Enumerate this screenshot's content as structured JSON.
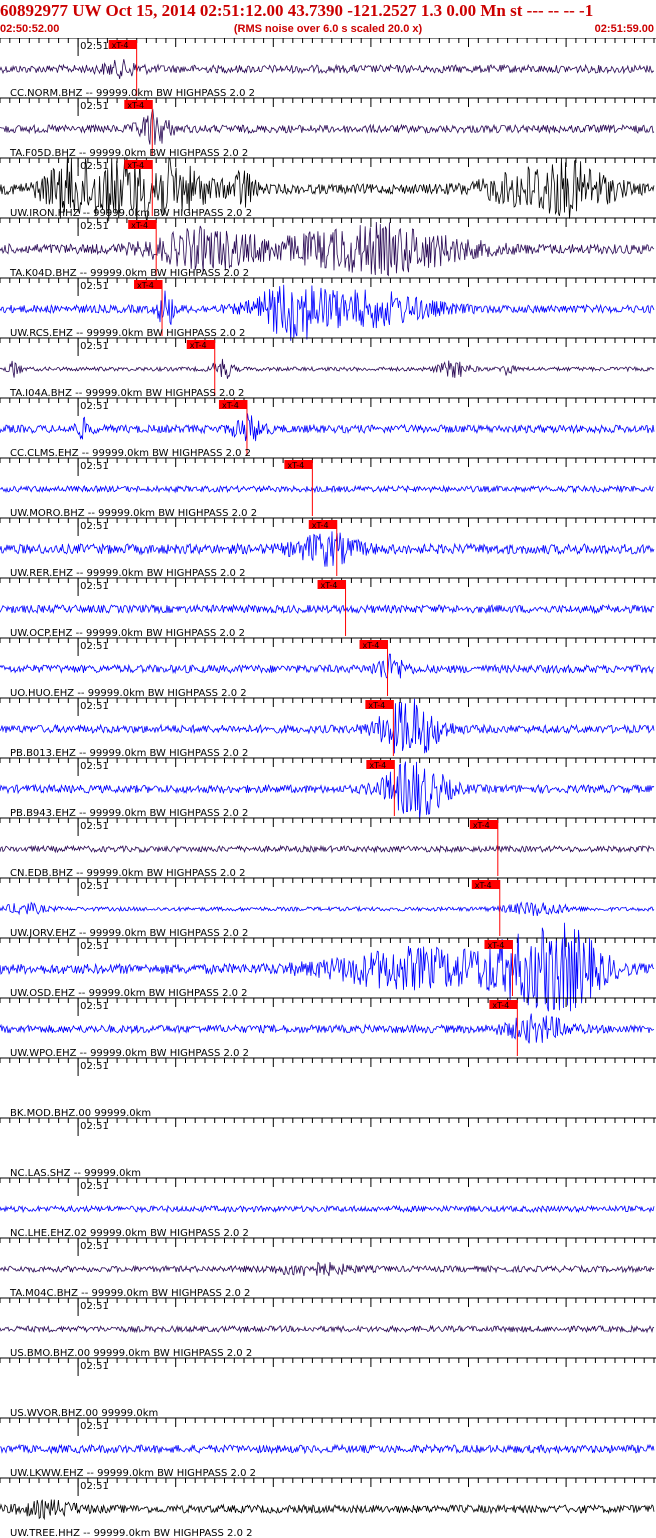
{
  "header": {
    "title": "60892977 UW Oct 15, 2014 02:51:12.00   43.7390 -121.2527  1.3 0.00 Mn st --- -- --  -1",
    "start_time": "02:50:52.00",
    "rms_note": "(RMS noise over 6.0 s scaled 20.0 x)",
    "end_time": "02:51:59.00"
  },
  "colors": {
    "header_red": "#cc0000",
    "pick_red": "#ff0000",
    "trace_blue": "#0000ff",
    "trace_purple": "#2a0a55",
    "trace_black": "#000000",
    "grid": "#000000"
  },
  "chart_data": {
    "type": "line",
    "title": "60892977 UW Oct 15, 2014 02:51:12.00   43.7390 -121.2527  1.3 0.00 Mn st --- -- --  -1",
    "x_range": [
      "02:50:52.00",
      "02:51:59.00"
    ],
    "x_range_seconds": [
      0,
      67
    ],
    "minute_label": "02:51",
    "minute_mark_seconds": 8,
    "pick_label": "xT-4",
    "traces": [
      {
        "label": "CC.NORM.BHZ -- 99999.0km BW  HIGHPASS  2.0  2",
        "color": "purple",
        "pick": 14.0,
        "amp": 4,
        "bursts": [
          [
            12.5,
            2.0,
            6
          ]
        ]
      },
      {
        "label": "TA.F05D.BHZ -- 99999.0km BW  HIGHPASS  2.0  2",
        "color": "purple",
        "pick": 15.6,
        "amp": 4,
        "bursts": [
          [
            15.8,
            1.5,
            16
          ]
        ]
      },
      {
        "label": "UW.IRON.HHZ -- 99999.0km BW  HIGHPASS  2.0  2",
        "color": "black",
        "pick": 15.6,
        "amp": 5,
        "bursts": [
          [
            6.5,
            1.8,
            12
          ],
          [
            9.5,
            4.5,
            22
          ],
          [
            16.5,
            5.0,
            26
          ],
          [
            25.0,
            1.0,
            18
          ],
          [
            54.5,
            5.0,
            16
          ],
          [
            59.0,
            4.0,
            18
          ]
        ]
      },
      {
        "label": "TA.K04D.BHZ -- 99999.0km BW  HIGHPASS  2.0  2",
        "color": "purple",
        "pick": 16.0,
        "amp": 5,
        "bursts": [
          [
            21.0,
            5.0,
            18
          ],
          [
            35.0,
            8.0,
            12
          ],
          [
            41.0,
            7.0,
            14
          ]
        ]
      },
      {
        "label": "UW.RCS.EHZ -- 99999.0km BW  HIGHPASS  2.0  2",
        "color": "blue",
        "pick": 16.6,
        "amp": 4,
        "bursts": [
          [
            17.0,
            0.8,
            18
          ],
          [
            30.0,
            3.5,
            26
          ],
          [
            38.0,
            6.0,
            16
          ]
        ]
      },
      {
        "label": "TA.I04A.BHZ -- 99999.0km BW  HIGHPASS  2.0  2",
        "color": "purple",
        "pick": 22.0,
        "amp": 2,
        "bursts": [
          [
            1.5,
            0.6,
            8
          ],
          [
            22.8,
            1.0,
            10
          ],
          [
            46.5,
            1.5,
            8
          ],
          [
            52.0,
            0.6,
            6
          ]
        ]
      },
      {
        "label": "CC.CLMS.EHZ -- 99999.0km BW  HIGHPASS  2.0  2",
        "color": "blue",
        "pick": 25.3,
        "amp": 4,
        "bursts": [
          [
            8.5,
            0.8,
            8
          ],
          [
            25.5,
            1.5,
            12
          ]
        ]
      },
      {
        "label": "UW.MORO.BHZ -- 99999.0km BW  HIGHPASS  2.0  2",
        "color": "blue",
        "pick": 32.0,
        "amp": 3,
        "bursts": []
      },
      {
        "label": "UW.RER.EHZ -- 99999.0km BW  HIGHPASS  2.0  2",
        "color": "blue",
        "pick": 34.5,
        "amp": 5,
        "bursts": [
          [
            33.5,
            3.0,
            14
          ]
        ]
      },
      {
        "label": "UW.OCP.EHZ -- 99999.0km BW  HIGHPASS  2.0  2",
        "color": "blue",
        "pick": 35.4,
        "amp": 4,
        "bursts": []
      },
      {
        "label": "UO.HUO.EHZ -- 99999.0km BW  HIGHPASS  2.0  2",
        "color": "blue",
        "pick": 39.7,
        "amp": 4,
        "bursts": [
          [
            40.0,
            1.5,
            12
          ]
        ]
      },
      {
        "label": "PB.B013.EHZ -- 99999.0km BW  HIGHPASS  2.0  2",
        "color": "blue",
        "pick": 40.3,
        "amp": 4,
        "bursts": [
          [
            42.0,
            3.0,
            28
          ]
        ]
      },
      {
        "label": "PB.B943.EHZ -- 99999.0km BW  HIGHPASS  2.0  2",
        "color": "blue",
        "pick": 40.4,
        "amp": 4,
        "bursts": [
          [
            42.5,
            3.0,
            28
          ]
        ]
      },
      {
        "label": "CN.EDB.BHZ -- 99999.0km BW  HIGHPASS  2.0  2",
        "color": "purple",
        "pick": 51.0,
        "amp": 3,
        "bursts": []
      },
      {
        "label": "UW.JORV.EHZ -- 99999.0km BW  HIGHPASS  2.0  2",
        "color": "blue",
        "pick": 51.2,
        "amp": 2,
        "bursts": [
          [
            2.5,
            2.0,
            5
          ],
          [
            55.0,
            3.0,
            6
          ]
        ]
      },
      {
        "label": "UW.OSD.EHZ -- 99999.0km BW  HIGHPASS  2.0  2",
        "color": "blue",
        "pick": 52.5,
        "amp": 5,
        "bursts": [
          [
            42.0,
            8.0,
            18
          ],
          [
            54.0,
            5.0,
            26
          ],
          [
            58.5,
            3.5,
            28
          ]
        ]
      },
      {
        "label": "UW.WPO.EHZ -- 99999.0km BW  HIGHPASS  2.0  2",
        "color": "blue",
        "pick": 53.0,
        "amp": 4,
        "bursts": [
          [
            55.0,
            3.0,
            12
          ]
        ]
      },
      {
        "label": "BK.MOD.BHZ.00 99999.0km",
        "color": "none",
        "pick": null,
        "amp": 0,
        "bursts": []
      },
      {
        "label": "NC.LAS.SHZ -- 99999.0km",
        "color": "none",
        "pick": null,
        "amp": 0,
        "bursts": []
      },
      {
        "label": "NC.LHE.EHZ.02 99999.0km BW  HIGHPASS  2.0  2",
        "color": "blue",
        "pick": null,
        "amp": 3,
        "bursts": []
      },
      {
        "label": "TA.M04C.BHZ -- 99999.0km BW  HIGHPASS  2.0  2",
        "color": "purple",
        "pick": null,
        "amp": 3,
        "bursts": [
          [
            32.0,
            4.0,
            5
          ]
        ]
      },
      {
        "label": "US.BMO.BHZ.00 99999.0km BW  HIGHPASS  2.0  2",
        "color": "purple",
        "pick": null,
        "amp": 3,
        "bursts": []
      },
      {
        "label": "US.WVOR.BHZ.00 99999.0km",
        "color": "none",
        "pick": null,
        "amp": 0,
        "bursts": []
      },
      {
        "label": "UW.LKWW.EHZ -- 99999.0km BW  HIGHPASS  2.0  2",
        "color": "blue",
        "pick": null,
        "amp": 4,
        "bursts": []
      },
      {
        "label": "UW.TREE.HHZ -- 99999.0km BW  HIGHPASS  2.0  2",
        "color": "black",
        "pick": null,
        "amp": 4,
        "bursts": [
          [
            5.0,
            3.0,
            6
          ]
        ]
      }
    ]
  }
}
